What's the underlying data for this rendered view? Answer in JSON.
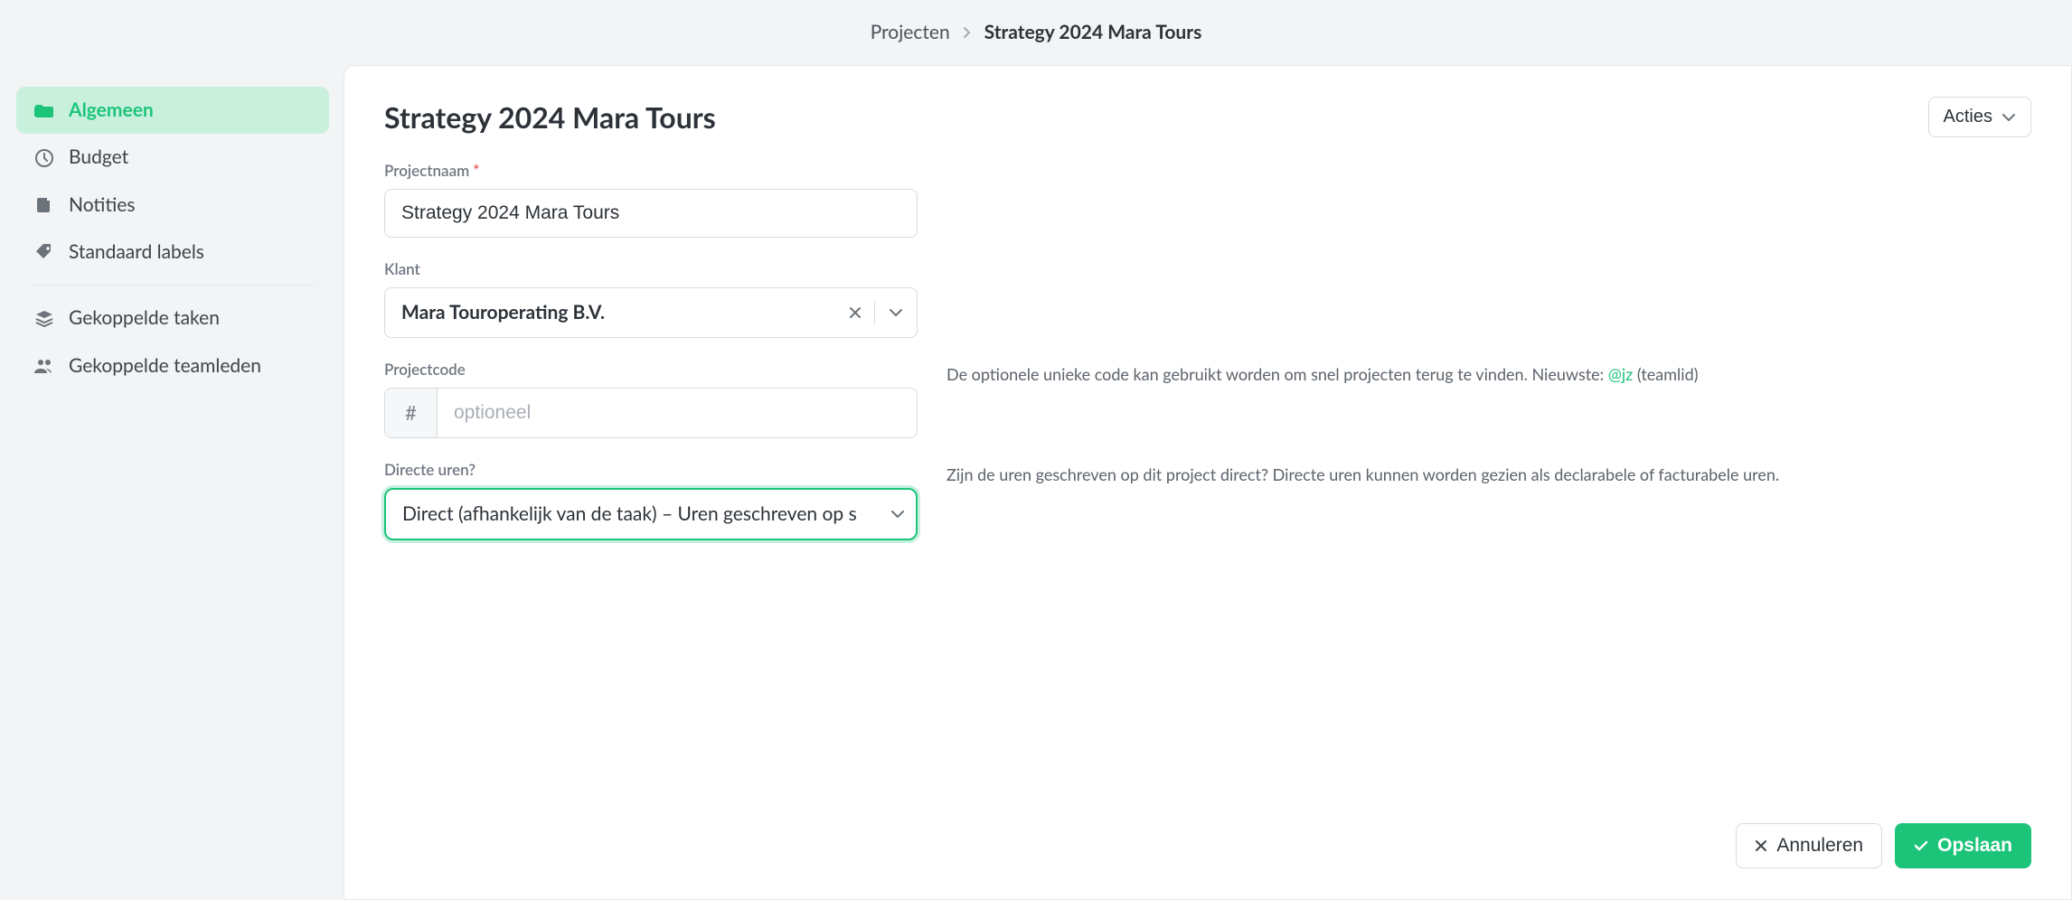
{
  "breadcrumb": {
    "parent": "Projecten",
    "current": "Strategy 2024 Mara Tours"
  },
  "sidebar": {
    "items": [
      {
        "icon": "folder-icon",
        "label": "Algemeen",
        "active": true
      },
      {
        "icon": "clock-icon",
        "label": "Budget",
        "active": false
      },
      {
        "icon": "note-icon",
        "label": "Notities",
        "active": false
      },
      {
        "icon": "tag-icon",
        "label": "Standaard labels",
        "active": false
      },
      {
        "icon": "stack-icon",
        "label": "Gekoppelde taken",
        "active": false
      },
      {
        "icon": "people-icon",
        "label": "Gekoppelde teamleden",
        "active": false
      }
    ]
  },
  "page": {
    "title": "Strategy 2024 Mara Tours",
    "actions_label": "Acties"
  },
  "form": {
    "project_name": {
      "label": "Projectnaam",
      "value": "Strategy 2024 Mara Tours"
    },
    "client": {
      "label": "Klant",
      "value": "Mara Touroperating B.V."
    },
    "project_code": {
      "label": "Projectcode",
      "prefix": "#",
      "placeholder": "optioneel",
      "help_before": "De optionele unieke code kan gebruikt worden om snel projecten terug te vinden. Nieuwste: ",
      "help_link": "@jz",
      "help_after": " (teamlid)"
    },
    "direct_hours": {
      "label": "Directe uren?",
      "value": "Direct (afhankelijk van de taak) – Uren geschreven op s",
      "help": "Zijn de uren geschreven op dit project direct? Directe uren kunnen worden gezien als declarabele of facturabele uren."
    }
  },
  "footer": {
    "cancel": "Annuleren",
    "save": "Opslaan"
  }
}
